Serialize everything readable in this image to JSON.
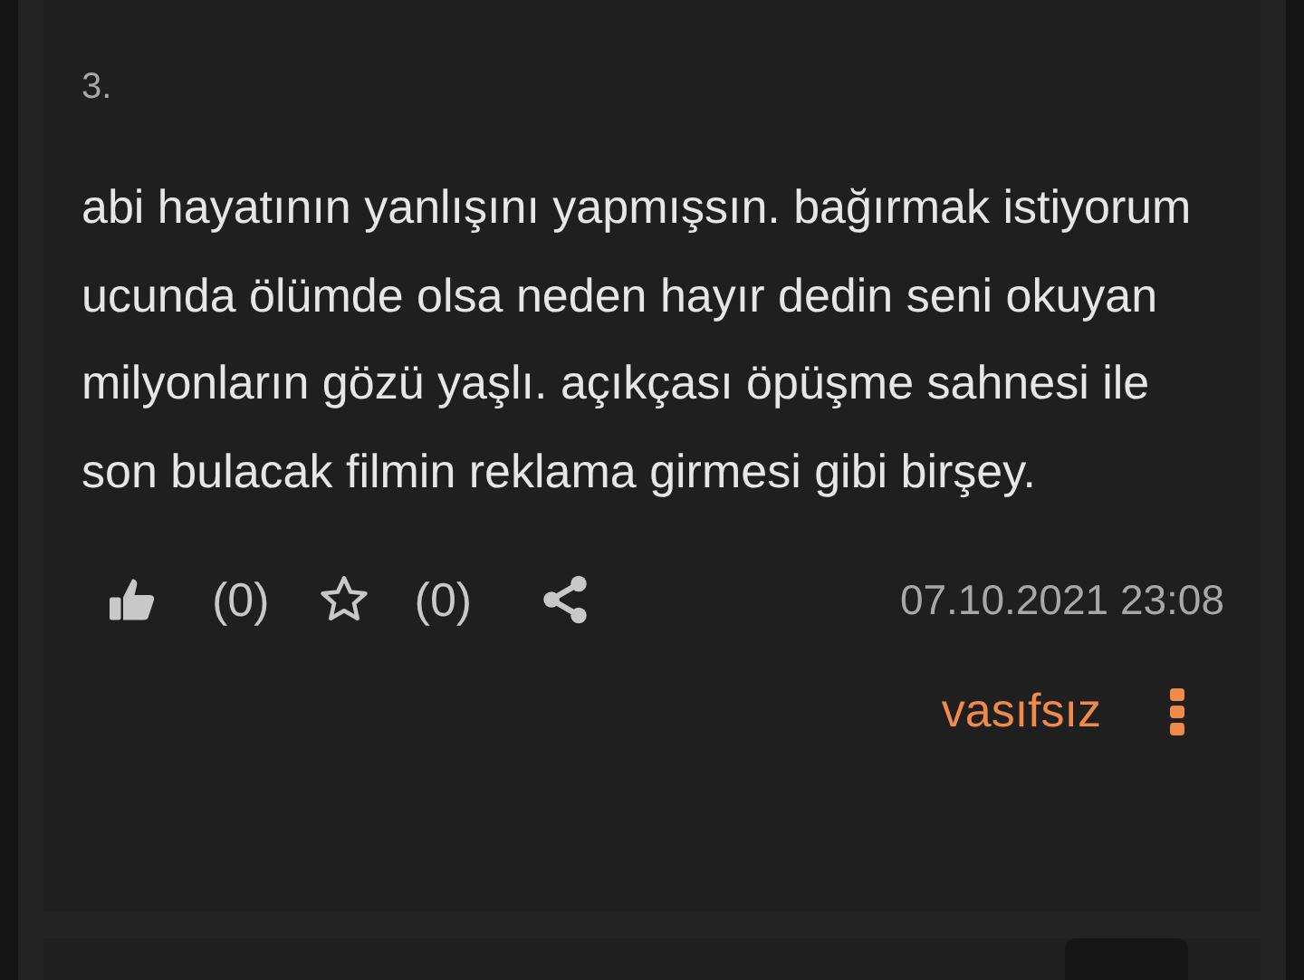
{
  "entry": {
    "number": "3.",
    "text": "abi hayatının yanlışını yapmışsın. bağırmak istiyorum ucunda ölümde olsa neden hayır dedin seni okuyan milyonların gözü yaşlı. açıkçası öpüşme sahnesi ile son bulacak filmin reklama girmesi gibi birşey.",
    "likes": "(0)",
    "favorites": "(0)",
    "date": "07.10.2021 23:08",
    "author": "vasıfsız"
  }
}
